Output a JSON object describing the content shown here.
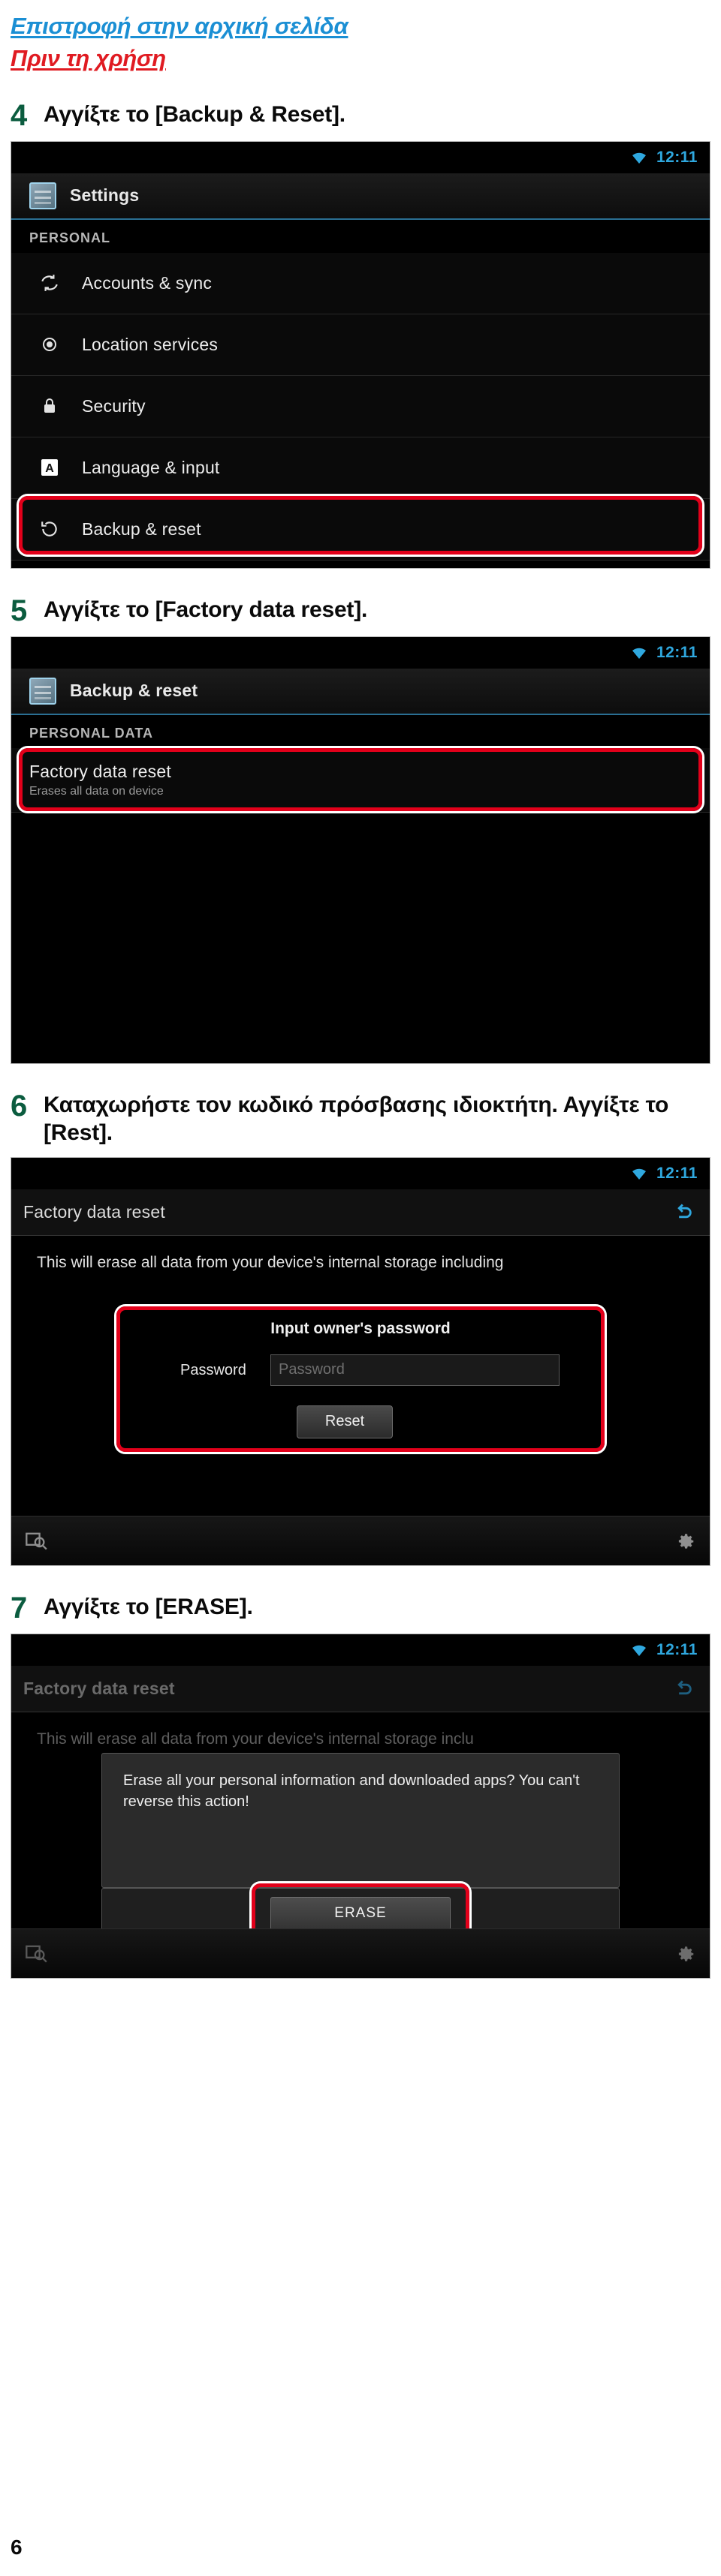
{
  "nav": {
    "home_link": "Επιστροφή στην αρχική σελίδα",
    "section_link": "Πριν τη χρήση",
    "home_color": "#1b8fd4",
    "section_color": "#e01b22"
  },
  "page_number": "6",
  "steps": [
    {
      "number": "4",
      "text": "Αγγίξτε το [Backup & Reset]."
    },
    {
      "number": "5",
      "text": "Αγγίξτε το [Factory data reset]."
    },
    {
      "number": "6",
      "text": "Καταχωρήστε τον κωδικό πρόσβασης ιδιοκτήτη. Αγγίξτε το [Rest]."
    },
    {
      "number": "7",
      "text": "Αγγίξτε το [ERASE]."
    }
  ],
  "screens": {
    "settings": {
      "status": {
        "clock": "12:11",
        "wifi_icon": "wifi-icon"
      },
      "title": "Settings",
      "app_icon": "settings-icon",
      "section_label": "PERSONAL",
      "rows": [
        {
          "label": "Accounts & sync",
          "icon": "sync-icon"
        },
        {
          "label": "Location services",
          "icon": "location-icon"
        },
        {
          "label": "Security",
          "icon": "lock-icon"
        },
        {
          "label": "Language & input",
          "icon": "keyboard-a-icon"
        },
        {
          "label": "Backup & reset",
          "icon": "backup-reset-icon",
          "highlighted": true
        }
      ]
    },
    "backup_reset": {
      "status": {
        "clock": "12:11",
        "wifi_icon": "wifi-icon"
      },
      "title": "Backup & reset",
      "app_icon": "settings-icon",
      "section_label": "PERSONAL DATA",
      "rows": [
        {
          "label": "Factory data reset",
          "sub": "Erases all data on device",
          "highlighted": true
        }
      ]
    },
    "factory_reset_password": {
      "status": {
        "clock": "12:11",
        "wifi_icon": "wifi-icon"
      },
      "title": "Factory data reset",
      "back_icon": "back-arrow-icon",
      "body": "This will erase all data from your device's internal storage including",
      "panel_title": "Input owner's password",
      "password_label": "Password",
      "password_placeholder": "Password",
      "password_value": "",
      "reset_button": "Reset",
      "toolbar": {
        "left_icon": "search-zoom-icon",
        "right_icon": "gear-icon"
      }
    },
    "erase_dialog": {
      "status": {
        "clock": "12:11",
        "wifi_icon": "wifi-icon"
      },
      "title": "Factory data reset",
      "back_icon": "back-arrow-icon",
      "body": "This will erase all data from your device's internal storage inclu",
      "dialog_text": "Erase all your personal information and downloaded apps? You can't reverse this action!",
      "erase_button": "ERASE",
      "toolbar": {
        "left_icon": "search-zoom-icon",
        "right_icon": "gear-icon"
      }
    }
  }
}
